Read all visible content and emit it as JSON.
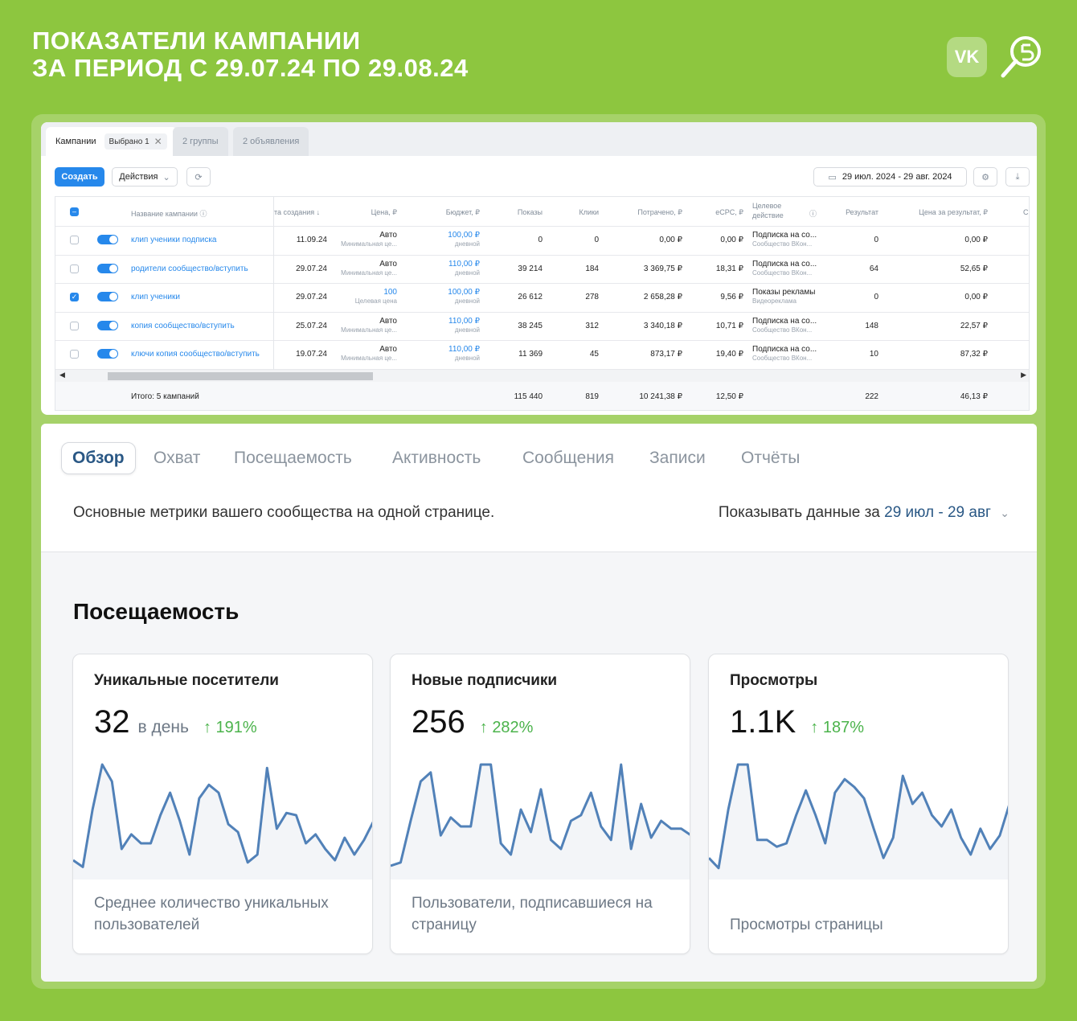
{
  "header": {
    "title_line1": "ПОКАЗАТЕЛИ КАМПАНИИ",
    "title_line2": "ЗА ПЕРИОД С 29.07.24 ПО 29.08.24",
    "vk_logo": "VK"
  },
  "ads": {
    "tabs": {
      "campaigns": "Кампании",
      "selected_chip": "Выбрано 1",
      "groups": "2 группы",
      "ads": "2 объявления"
    },
    "toolbar": {
      "create": "Создать",
      "actions": "Действия",
      "date_range": "29 июл. 2024 - 29 авг. 2024"
    },
    "columns": {
      "name": "Название кампании",
      "created": "та создания ↓",
      "price": "Цена, ₽",
      "budget": "Бюджет, ₽",
      "shows": "Показы",
      "clicks": "Клики",
      "spent": "Потрачено, ₽",
      "ecpc": "eCPC, ₽",
      "target_l1": "Целевое",
      "target_l2": "действие",
      "result": "Результат",
      "price_result": "Цена за результат, ₽",
      "cut": "С"
    },
    "rows": [
      {
        "name": "клип ученики подписка",
        "created": "11.09.24",
        "price": "Авто",
        "price_sub": "Минимальная це...",
        "budget": "100,00 ₽",
        "budget_sub": "дневной",
        "shows": "0",
        "clicks": "0",
        "spent": "0,00 ₽",
        "ecpc": "0,00 ₽",
        "target": "Подписка на со...",
        "target_sub": "Сообщество ВКон...",
        "result": "0",
        "price_result": "0,00 ₽",
        "checked": false
      },
      {
        "name": "родители сообщество/вступить",
        "created": "29.07.24",
        "price": "Авто",
        "price_sub": "Минимальная це...",
        "budget": "110,00 ₽",
        "budget_sub": "дневной",
        "shows": "39 214",
        "clicks": "184",
        "spent": "3 369,75 ₽",
        "ecpc": "18,31 ₽",
        "target": "Подписка на со...",
        "target_sub": "Сообщество ВКон...",
        "result": "64",
        "price_result": "52,65 ₽",
        "checked": false
      },
      {
        "name": "клип ученики",
        "created": "29.07.24",
        "price": "100",
        "price_sub": "Целевая цена",
        "budget": "100,00 ₽",
        "budget_sub": "дневной",
        "shows": "26 612",
        "clicks": "278",
        "spent": "2 658,28 ₽",
        "ecpc": "9,56 ₽",
        "target": "Показы рекламы",
        "target_sub": "Видеореклама",
        "result": "0",
        "price_result": "0,00 ₽",
        "checked": true
      },
      {
        "name": "копия сообщество/вступить",
        "created": "25.07.24",
        "price": "Авто",
        "price_sub": "Минимальная це...",
        "budget": "110,00 ₽",
        "budget_sub": "дневной",
        "shows": "38 245",
        "clicks": "312",
        "spent": "3 340,18 ₽",
        "ecpc": "10,71 ₽",
        "target": "Подписка на со...",
        "target_sub": "Сообщество ВКон...",
        "result": "148",
        "price_result": "22,57 ₽",
        "checked": false
      },
      {
        "name": "ключи копия сообщество/вступить",
        "created": "19.07.24",
        "price": "Авто",
        "price_sub": "Минимальная це...",
        "budget": "110,00 ₽",
        "budget_sub": "дневной",
        "shows": "11 369",
        "clicks": "45",
        "spent": "873,17 ₽",
        "ecpc": "19,40 ₽",
        "target": "Подписка на со...",
        "target_sub": "Сообщество ВКон...",
        "result": "10",
        "price_result": "87,32 ₽",
        "checked": false
      }
    ],
    "totals": {
      "label": "Итого: 5 кампаний",
      "shows": "115 440",
      "clicks": "819",
      "spent": "10 241,38 ₽",
      "ecpc": "12,50 ₽",
      "result": "222",
      "price_result": "46,13 ₽"
    }
  },
  "stats": {
    "tabs": [
      "Обзор",
      "Охват",
      "Посещаемость",
      "Активность",
      "Сообщения",
      "Записи",
      "Отчёты"
    ],
    "description": "Основные метрики вашего сообщества на одной странице.",
    "period_label": "Показывать данные за",
    "period_value": "29 июл - 29 авг",
    "section_title": "Посещаемость",
    "cards": [
      {
        "title": "Уникальные посетители",
        "value": "32",
        "unit": "в день",
        "delta": "191%",
        "footer": "Среднее количество уникальных пользователей",
        "series": [
          10,
          4,
          55,
          95,
          80,
          20,
          33,
          25,
          25,
          50,
          70,
          45,
          15,
          65,
          77,
          70,
          42,
          35,
          8,
          15,
          92,
          38,
          52,
          50,
          25,
          33,
          20,
          10,
          30,
          15,
          28,
          45
        ]
      },
      {
        "title": "Новые подписчики",
        "value": "256",
        "unit": "",
        "delta": "282%",
        "footer": "Пользователи, подписавшиеся на страницу",
        "series": [
          5,
          8,
          45,
          80,
          88,
          32,
          48,
          40,
          40,
          95,
          95,
          25,
          15,
          55,
          35,
          73,
          28,
          20,
          45,
          50,
          70,
          40,
          28,
          95,
          20,
          60,
          30,
          45,
          38,
          38,
          32
        ]
      },
      {
        "title": "Просмотры",
        "value": "1.1K",
        "unit": "",
        "delta": "187%",
        "footer": "Просмотры страницы",
        "series": [
          12,
          3,
          55,
          95,
          95,
          28,
          28,
          22,
          25,
          50,
          72,
          50,
          25,
          70,
          82,
          75,
          65,
          38,
          12,
          30,
          85,
          60,
          70,
          50,
          40,
          55,
          30,
          15,
          38,
          20,
          32,
          60
        ]
      }
    ],
    "delta_arrow": "↑"
  },
  "colors": {
    "background": "#8dc63f",
    "accent": "#2688eb",
    "line": "#5181b8",
    "positive": "#4bb34b"
  }
}
